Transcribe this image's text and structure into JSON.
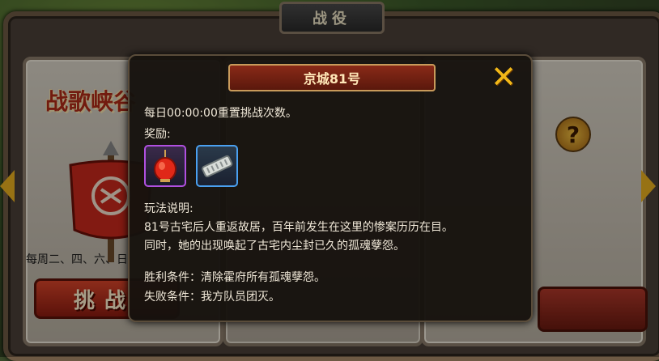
{
  "screen_title": "战役",
  "cards": [
    {
      "title": "战歌峡谷",
      "schedule": "每周二、四、六、日",
      "button_label": "挑战"
    }
  ],
  "help_label": "?",
  "modal": {
    "title": "京城81号",
    "reset_text": "每日00:00:00重置挑战次数。",
    "reward_label": "奖励:",
    "rewards": [
      {
        "icon": "red-lantern-icon"
      },
      {
        "icon": "scroll-item-icon"
      }
    ],
    "gameplay_heading": "玩法说明:",
    "gameplay_line1": "81号古宅后人重返故居，百年前发生在这里的惨案历历在目。",
    "gameplay_line2": "同时，她的出现唤起了古宅内尘封已久的孤魂孽怨。",
    "win_condition": "胜利条件：清除霍府所有孤魂孽怨。",
    "lose_condition": "失败条件：我方队员团灭。",
    "close_icon": "✕"
  },
  "colors": {
    "accent_gold": "#e8b020",
    "title_red": "#b02a18",
    "button_red": "#d8442a"
  }
}
